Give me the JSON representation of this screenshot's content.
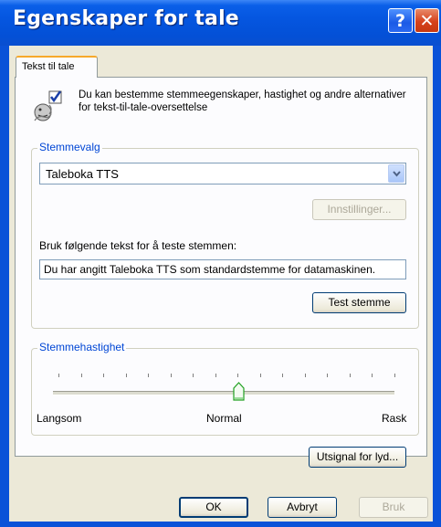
{
  "window": {
    "title": "Egenskaper for tale"
  },
  "title_buttons": {
    "help_label": "?",
    "close_label": "✕"
  },
  "tabs": [
    {
      "label": "Tekst til tale",
      "selected": true
    }
  ],
  "description": "Du kan bestemme stemmeegenskaper, hastighet og andre alternativer for tekst-til-tale-oversettelse",
  "voice_group": {
    "label": "Stemmevalg",
    "selected_voice": "Taleboka TTS",
    "settings_button": "Innstillinger...",
    "test_prompt": "Bruk følgende tekst for å teste stemmen:",
    "test_text": "Du har angitt Taleboka TTS som standardstemme for datamaskinen.",
    "test_button": "Test stemme"
  },
  "speed_group": {
    "label": "Stemmehastighet",
    "slider_value": 0.5,
    "tick_count": 16,
    "min_label": "Langsom",
    "mid_label": "Normal",
    "max_label": "Rask"
  },
  "audio_output_button": "Utsignal for lyd...",
  "footer": {
    "ok": "OK",
    "cancel": "Avbryt",
    "apply": "Bruk"
  },
  "colors": {
    "titlebar": "#0556e0",
    "group_label": "#0046d5",
    "dialog_bg": "#ece9d8"
  }
}
